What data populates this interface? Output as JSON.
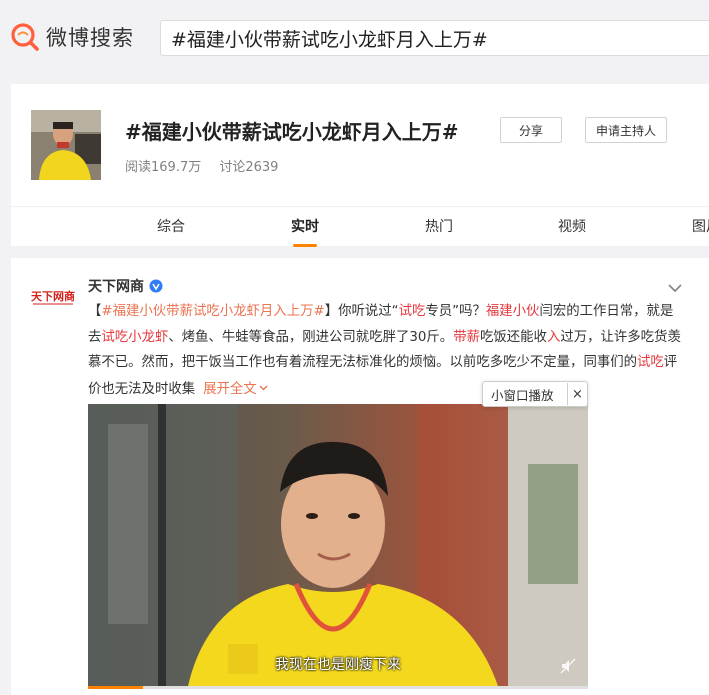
{
  "header": {
    "logo_text": "微博搜索",
    "search_value": "#福建小伙带薪试吃小龙虾月入上万#"
  },
  "topic": {
    "title": "#福建小伙带薪试吃小龙虾月入上万#",
    "read_count": "阅读169.7万",
    "discuss_count": "讨论2639",
    "share_label": "分享",
    "host_label": "申请主持人"
  },
  "tabs": [
    {
      "label": "综合",
      "active": false
    },
    {
      "label": "实时",
      "active": true
    },
    {
      "label": "热门",
      "active": false
    },
    {
      "label": "视频",
      "active": false
    },
    {
      "label": "图片",
      "active": false
    }
  ],
  "post": {
    "author": "天下网商",
    "avatar_text": "天下网商",
    "text_parts": {
      "bracket_open": "【",
      "hashtag": "#福建小伙带薪试吃小龙虾月入上万#",
      "p1": "】你听说过“",
      "k1": "试吃",
      "p2": "专员”吗？",
      "k2": "福建小伙",
      "p3": "闫宏的工作日常，就是去",
      "k3": "试吃小龙虾",
      "p4": "、烤鱼、牛蛙等食品，刚进公司就吃胖了30斤。",
      "k4": "带薪",
      "p5": "吃饭还能收",
      "k5": "入",
      "p6": "过万，让许多吃货羡慕不已。然而，把干饭当工作也有着流程无法标准化的烦恼。以前吃多吃少不定量，同事们的",
      "k6": "试吃",
      "p7": "评价也无法及时收集",
      "expand": "展开全文"
    },
    "video_subtitle": "我现在也是刚瘦下来",
    "progress": 0.11,
    "mini_player_label": "小窗口播放",
    "mini_close": "×"
  },
  "colors": {
    "accent": "#ff8200",
    "link": "#eb7350",
    "keyword": "#e6393e"
  }
}
